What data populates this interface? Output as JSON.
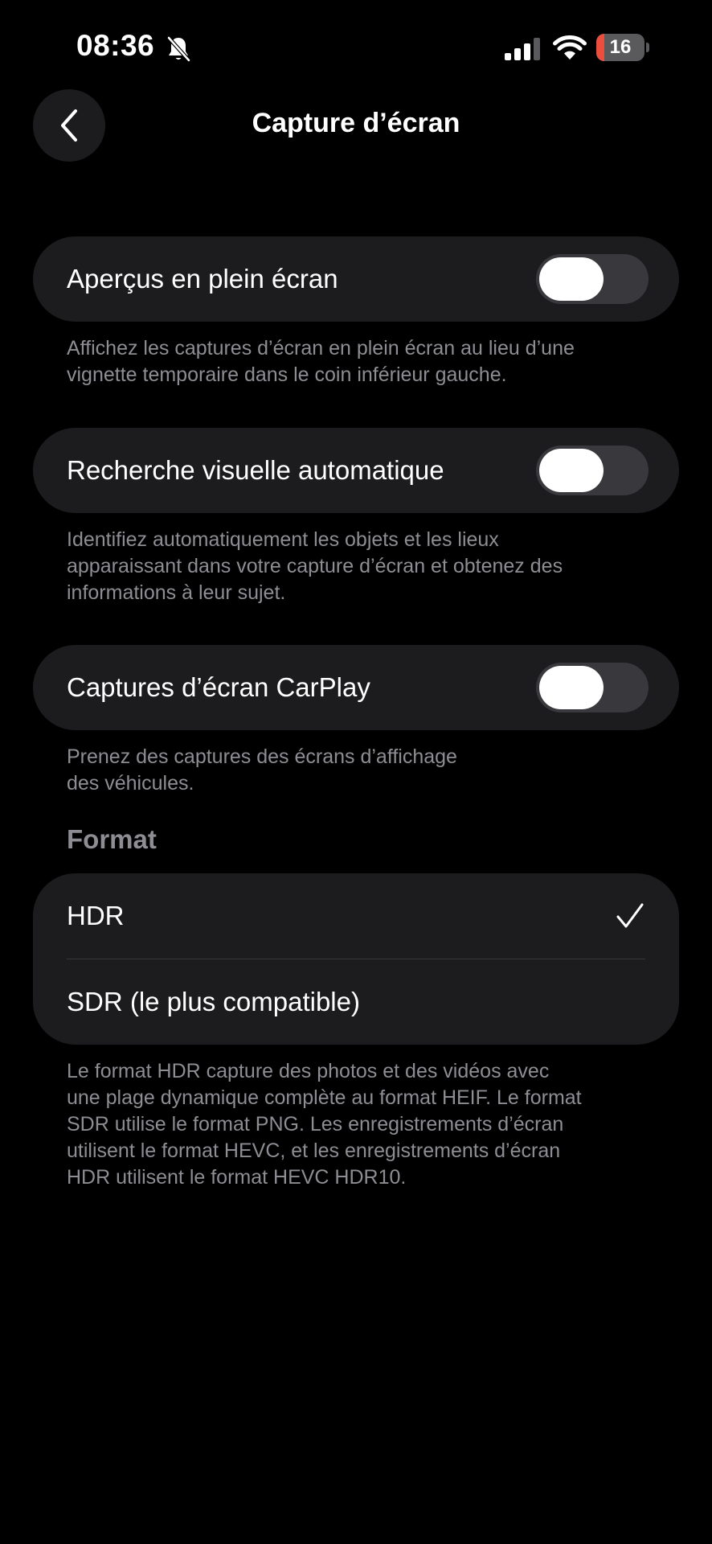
{
  "status_bar": {
    "time": "08:36",
    "battery_level": "16",
    "battery_fraction": 0.16,
    "icons": [
      "bell-slash-icon",
      "cellular-signal-icon",
      "wifi-icon",
      "battery-icon"
    ]
  },
  "nav": {
    "back_icon": "chevron-left-icon",
    "title": "Capture d’écran"
  },
  "settings": [
    {
      "label": "Aperçus en plein écran",
      "enabled": false,
      "footnote_lines": [
        "Affichez les captures d’écran en plein écran au lieu d’une",
        "vignette temporaire dans le coin inférieur gauche."
      ]
    },
    {
      "label": "Recherche visuelle automatique",
      "enabled": false,
      "footnote_lines": [
        "Identifiez automatiquement les objets et les lieux",
        "apparaissant dans votre capture d’écran et obtenez des",
        "informations à leur sujet."
      ]
    },
    {
      "label": "Captures d’écran CarPlay",
      "enabled": false,
      "footnote_lines": [
        "Prenez des captures des écrans d’affichage",
        "des véhicules."
      ]
    }
  ],
  "format": {
    "header": "Format",
    "options": [
      {
        "label": "HDR",
        "selected": true
      },
      {
        "label": "SDR (le plus compatible)",
        "selected": false
      }
    ],
    "footnote_lines": [
      "Le format HDR capture des photos et des vidéos avec",
      "une plage dynamique complète au format HEIF. Le format",
      "SDR utilise le format PNG. Les enregistrements d’écran",
      "utilisent le format HEVC, et les enregistrements d’écran",
      "HDR utilisent le format HEVC HDR10."
    ]
  },
  "colors": {
    "background": "#000000",
    "card": "#1c1c1e",
    "toggle_off": "#39393d",
    "secondary_text": "#8d8d93",
    "battery_low": "#eb4e3d"
  }
}
